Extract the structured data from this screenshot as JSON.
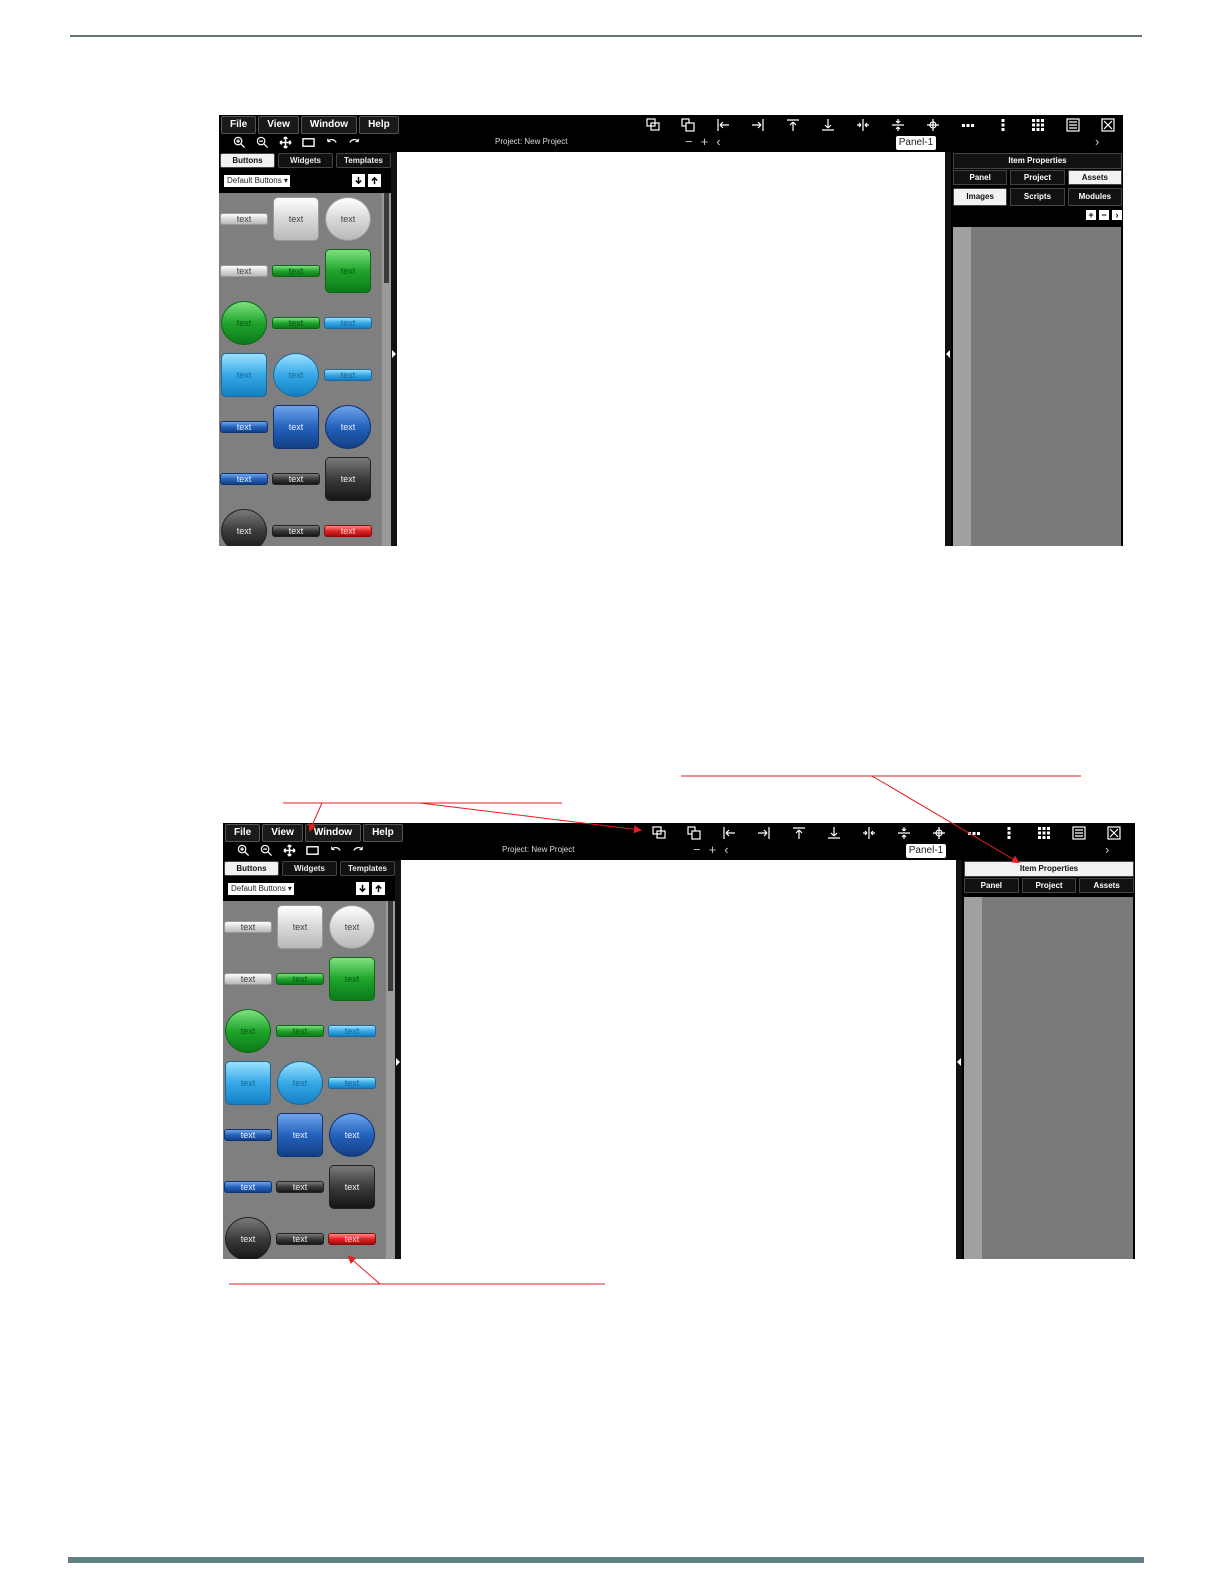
{
  "menus": [
    "File",
    "View",
    "Window",
    "Help"
  ],
  "toolbar_icons": [
    "bring-front-icon",
    "send-back-icon",
    "align-left-icon",
    "align-right-icon",
    "align-top-icon",
    "align-bottom-icon",
    "center-horizontal-icon",
    "center-vertical-icon",
    "center-both-icon",
    "distribute-horizontal-icon",
    "distribute-vertical-icon",
    "grid-icon",
    "list-icon",
    "close-box-icon"
  ],
  "zoom_icons": [
    "zoom-in-icon",
    "zoom-out-icon",
    "move-icon",
    "rectangle-icon",
    "undo-icon",
    "redo-icon"
  ],
  "project_label": "Project: New Project",
  "nav": {
    "minus": "−",
    "plus": "+",
    "prev": "‹",
    "next": "›"
  },
  "panel_chip": "Panel-1",
  "left_tabs": [
    "Buttons",
    "Widgets",
    "Templates"
  ],
  "left_select": "Default Buttons ▾",
  "button_label": "text",
  "right_title": "Item Properties",
  "right_tabs": [
    "Panel",
    "Project",
    "Assets"
  ],
  "right_subtabs": [
    "Images",
    "Scripts",
    "Modules"
  ],
  "right_actions": [
    "+",
    "−",
    "›"
  ],
  "colors": {
    "annotation_red": "#e01f1f",
    "rule_gray": "#5f7f82",
    "palette_bg": "#7f7f7f"
  }
}
